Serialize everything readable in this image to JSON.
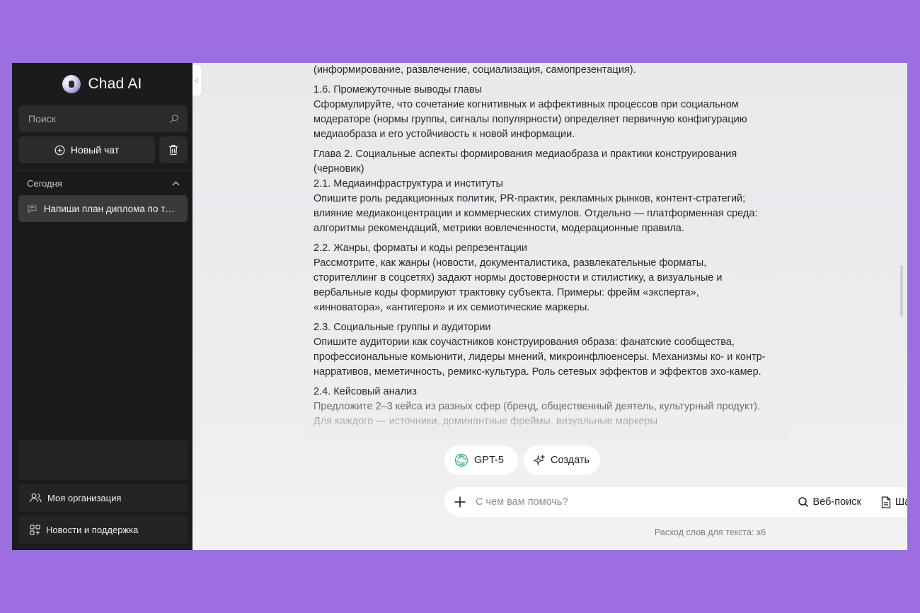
{
  "app": {
    "title": "Chad AI"
  },
  "sidebar": {
    "search_placeholder": "Поиск",
    "new_chat_label": "Новый чат",
    "section_label": "Сегодня",
    "history": [
      {
        "label": "Напиши план диплома по теме ..."
      }
    ],
    "bottom_items": [
      {
        "label": "Моя организация",
        "icon": "users-icon"
      },
      {
        "label": "Новости и поддержка",
        "icon": "grid-plus-icon"
      }
    ]
  },
  "message": {
    "blocks": [
      {
        "heading": "",
        "text": "(информирование, развлечение, социализация, самопрезентация)."
      },
      {
        "heading": "1.6. Промежуточные выводы главы",
        "text": "Сформулируйте, что сочетание когнитивных и аффективных процессов при социальном модераторе (нормы группы, сигналы популярности) определяет первичную конфигурацию медиаобраза и его устойчивость к новой информации."
      },
      {
        "heading": "Глава 2. Социальные аспекты формирования медиаобраза и практики конструирования (черновик)",
        "text": ""
      },
      {
        "heading": "2.1. Медиаинфраструктура и институты",
        "text": "Опишите роль редакционных политик, PR-практик, рекламных рынков, контент-стратегий; влияние медиаконцентрации и коммерческих стимулов. Отдельно — платформенная среда: алгоритмы рекомендаций, метрики вовлеченности, модерационные правила."
      },
      {
        "heading": "2.2. Жанры, форматы и коды репрезентации",
        "text": "Рассмотрите, как жанры (новости, документалистика, развлекательные форматы, сторителлинг в соцсетях) задают нормы достоверности и стилистику, а визуальные и вербальные коды формируют трактовку субъекта. Примеры: фрейм «эксперта», «инноватора», «антигероя» и их семиотические маркеры."
      },
      {
        "heading": "2.3. Социальные группы и аудитории",
        "text": "Опишите аудитории как соучастников конструирования образа: фанатские сообщества, профессиональные комьюнити, лидеры мнений, микроинфлюенсеры. Механизмы ко- и контр-нарративов, меметичность, ремикс-культура. Роль сетевых эффектов и эффектов эхо-камер."
      },
      {
        "heading": "2.4. Кейсовый анализ",
        "text": "Предложите 2–3 кейса из разных сфер (бренд, общественный деятель, культурный продукт). Для каждого — источники, доминантные фреймы, визуальные маркеры"
      }
    ]
  },
  "toolbar": {
    "model_label": "GPT-5",
    "create_label": "Создать"
  },
  "composer": {
    "placeholder": "С чем вам помочь?",
    "web_search_label": "Веб-поиск",
    "templates_label": "Шаблоны"
  },
  "footer": {
    "usage_note": "Расход слов для текста: x6"
  },
  "colors": {
    "background": "#9b6fe0",
    "sidebar": "#1b1b1b",
    "model_icon": "#3fb39a"
  }
}
